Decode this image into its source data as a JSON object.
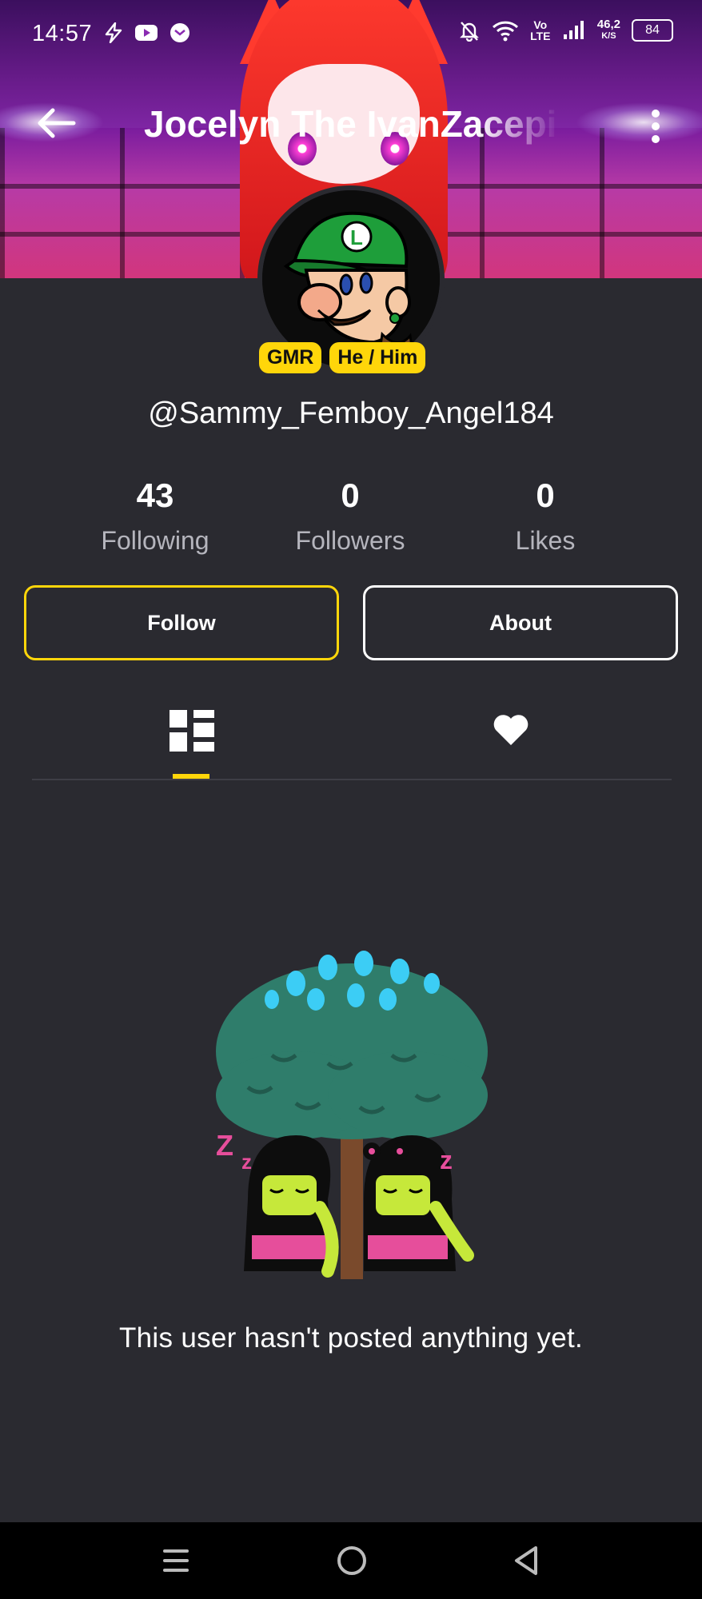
{
  "status_bar": {
    "time": "14:57",
    "network_text": "Vo LTE",
    "speed_value": "46,2",
    "speed_unit": "K/S",
    "battery": "84"
  },
  "header": {
    "title": "Jocelyn The IvanZacepi"
  },
  "profile": {
    "badges": [
      "GMR",
      "He / Him"
    ],
    "username": "@Sammy_Femboy_Angel184",
    "stats": [
      {
        "value": "43",
        "label": "Following"
      },
      {
        "value": "0",
        "label": "Followers"
      },
      {
        "value": "0",
        "label": "Likes"
      }
    ],
    "buttons": {
      "follow": "Follow",
      "about": "About"
    }
  },
  "tabs": [
    {
      "icon": "grid-icon",
      "selected": true
    },
    {
      "icon": "heart-icon",
      "selected": false
    }
  ],
  "empty_state": {
    "message": "This user hasn't posted anything yet."
  },
  "colors": {
    "accent": "#ffd60a",
    "background": "#2a2a30",
    "navbar": "#000000"
  }
}
